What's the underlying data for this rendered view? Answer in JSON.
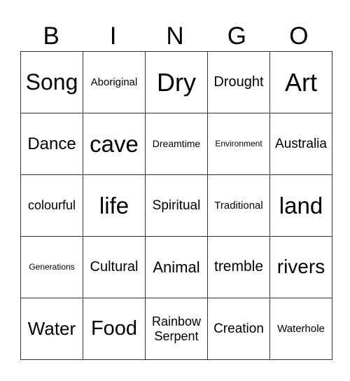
{
  "header": [
    "B",
    "I",
    "N",
    "G",
    "O"
  ],
  "cells": [
    [
      {
        "t": "Song",
        "s": 32
      },
      {
        "t": "Aboriginal",
        "s": 15
      },
      {
        "t": "Dry",
        "s": 36
      },
      {
        "t": "Drought",
        "s": 20
      },
      {
        "t": "Art",
        "s": 36
      }
    ],
    [
      {
        "t": "Dance",
        "s": 24
      },
      {
        "t": "cave",
        "s": 33
      },
      {
        "t": "Dreamtime",
        "s": 14
      },
      {
        "t": "Environment",
        "s": 12
      },
      {
        "t": "Australia",
        "s": 19
      }
    ],
    [
      {
        "t": "colourful",
        "s": 18
      },
      {
        "t": "life",
        "s": 33
      },
      {
        "t": "Spiritual",
        "s": 19
      },
      {
        "t": "Traditional",
        "s": 15
      },
      {
        "t": "land",
        "s": 33
      }
    ],
    [
      {
        "t": "Generations",
        "s": 12
      },
      {
        "t": "Cultural",
        "s": 20
      },
      {
        "t": "Animal",
        "s": 22
      },
      {
        "t": "tremble",
        "s": 21
      },
      {
        "t": "rivers",
        "s": 28
      }
    ],
    [
      {
        "t": "Water",
        "s": 26
      },
      {
        "t": "Food",
        "s": 29
      },
      {
        "t": "Rainbow Serpent",
        "s": 18
      },
      {
        "t": "Creation",
        "s": 19
      },
      {
        "t": "Waterhole",
        "s": 15
      }
    ]
  ]
}
